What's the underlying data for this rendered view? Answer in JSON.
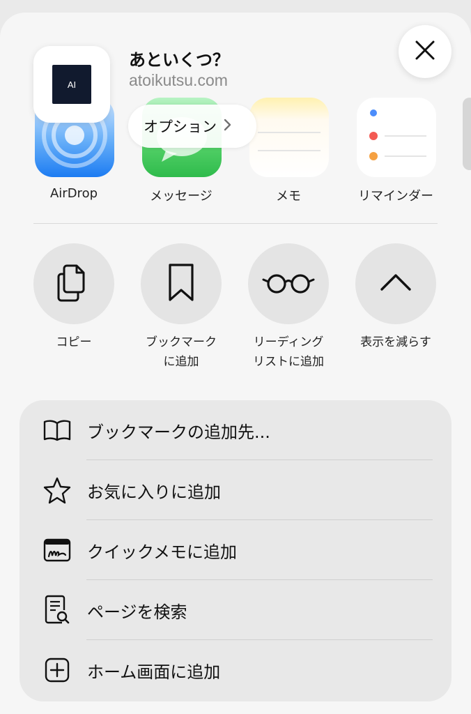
{
  "header": {
    "site_title": "あといくつ？",
    "site_domain": "atoikutsu.com",
    "app_icon_text": "AI",
    "options_label": "オプション",
    "close_icon": "close-icon"
  },
  "apps": [
    {
      "label": "AirDrop",
      "icon": "airdrop-icon"
    },
    {
      "label": "メッセージ",
      "icon": "messages-icon"
    },
    {
      "label": "メモ",
      "icon": "notes-icon"
    },
    {
      "label": "リマインダー",
      "icon": "reminders-icon"
    }
  ],
  "actions": [
    {
      "label_line1": "コピー",
      "label_line2": "",
      "icon": "copy-icon"
    },
    {
      "label_line1": "ブックマーク",
      "label_line2": "に追加",
      "icon": "bookmark-icon"
    },
    {
      "label_line1": "リーディング",
      "label_line2": "リストに追加",
      "icon": "glasses-icon"
    },
    {
      "label_line1": "表示を減らす",
      "label_line2": "",
      "icon": "chevron-up-icon"
    }
  ],
  "menu": [
    {
      "label": "ブックマークの追加先...",
      "icon": "book-icon"
    },
    {
      "label": "お気に入りに追加",
      "icon": "star-icon"
    },
    {
      "label": "クイックメモに追加",
      "icon": "quick-note-icon"
    },
    {
      "label": "ページを検索",
      "icon": "find-on-page-icon"
    },
    {
      "label": "ホーム画面に追加",
      "icon": "add-square-icon"
    }
  ]
}
